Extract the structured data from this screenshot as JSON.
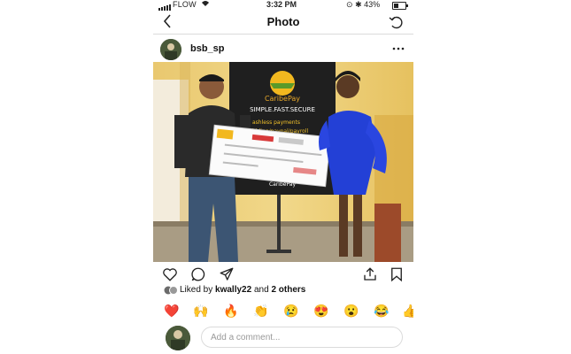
{
  "status_bar": {
    "carrier": "FLOW",
    "time": "3:32 PM",
    "battery": "43%",
    "battery_level": 0.43
  },
  "nav": {
    "title": "Photo",
    "back_icon": "chevron-left-icon",
    "refresh_icon": "refresh-icon"
  },
  "post": {
    "username": "bsb_sp",
    "more_icon": "more-horizontal-icon",
    "photo": {
      "banner_brand": "CaribePay",
      "banner_tagline": "SIMPLE.FAST.SECURE",
      "banner_line1": "ashless payments",
      "banner_line2": "idding/paypal/payroll",
      "banner_footer": "CaribePay"
    },
    "likes": {
      "prefix": "Liked by ",
      "user": "kwally22",
      "middle": " and ",
      "others": "2 others"
    }
  },
  "actions": {
    "like_icon": "heart-icon",
    "comment_icon": "comment-icon",
    "share_icon": "paper-plane-icon",
    "upload_icon": "upload-icon",
    "save_icon": "bookmark-icon"
  },
  "emojis": [
    "❤️",
    "🙌",
    "🔥",
    "👏",
    "😢",
    "😍",
    "😮",
    "😂",
    "👍"
  ],
  "comment": {
    "placeholder": "Add a comment..."
  }
}
